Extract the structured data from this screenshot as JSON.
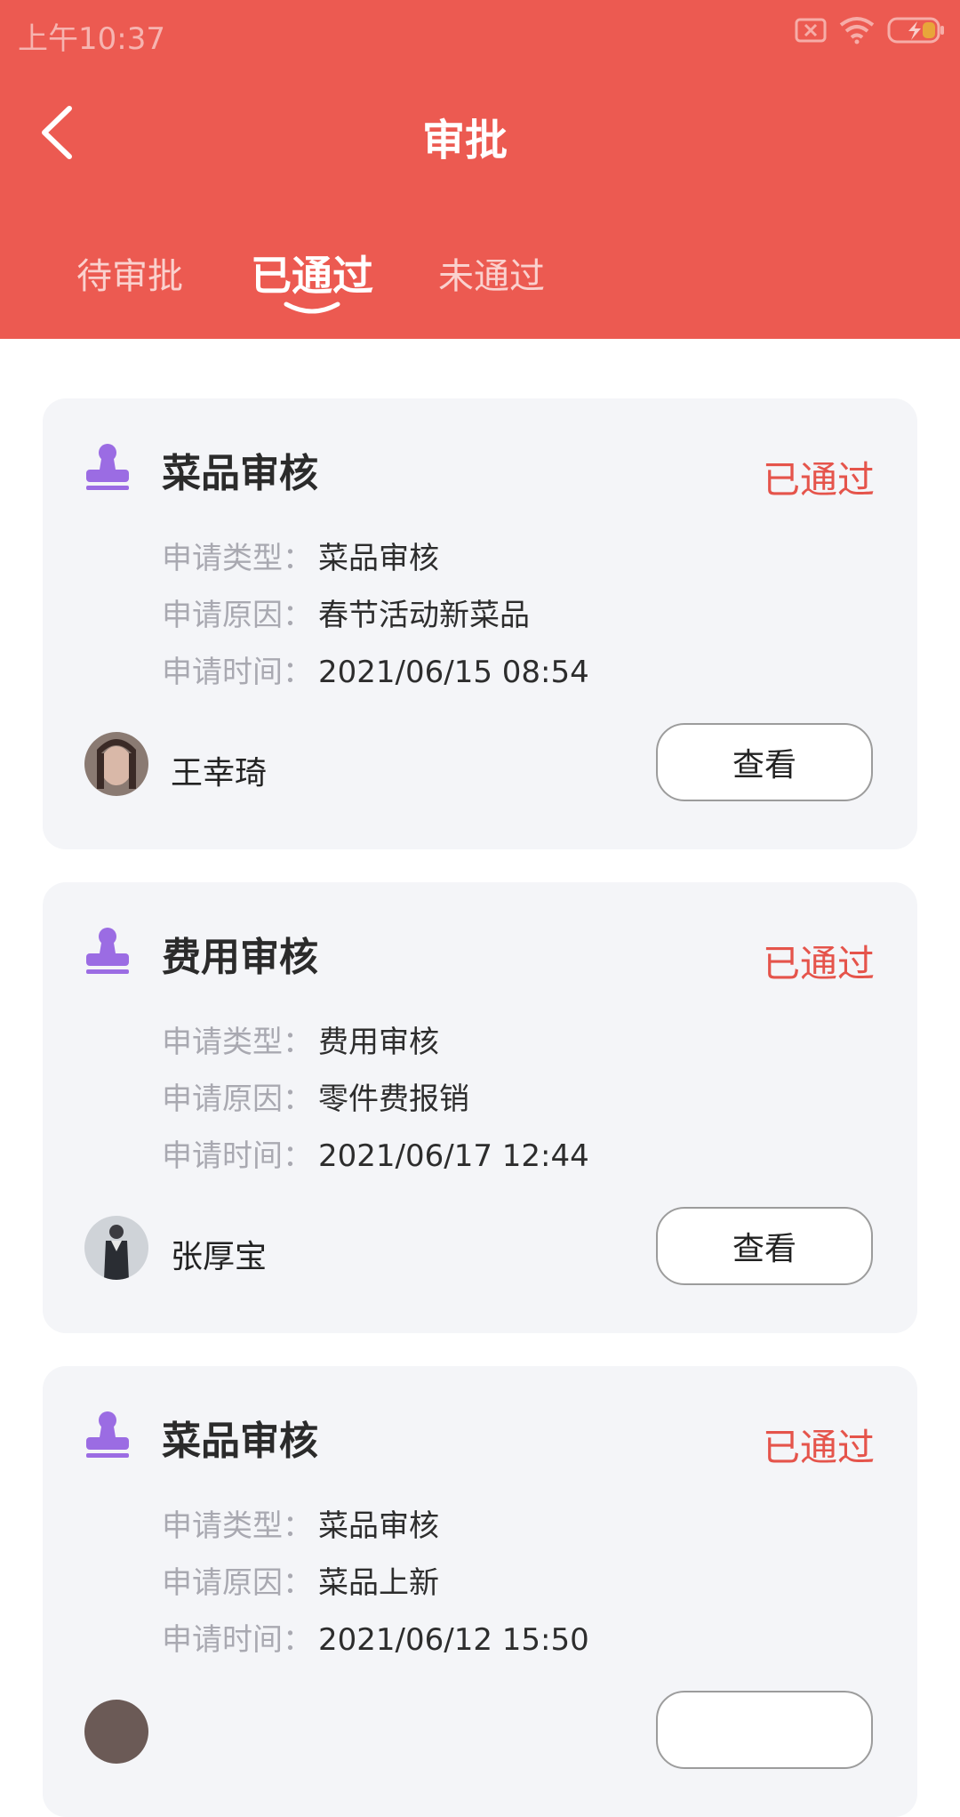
{
  "status_bar": {
    "time": "上午10:37"
  },
  "header": {
    "title": "审批"
  },
  "tabs": [
    {
      "label": "待审批"
    },
    {
      "label": "已通过"
    },
    {
      "label": "未通过"
    }
  ],
  "labels": {
    "type": "申请类型：",
    "reason": "申请原因：",
    "time": "申请时间："
  },
  "cards": [
    {
      "title": "菜品审核",
      "status": "已通过",
      "type": "菜品审核",
      "reason": "春节活动新菜品",
      "time": "2021/06/15 08:54",
      "applicant": "王幸琦",
      "button": "查看"
    },
    {
      "title": "费用审核",
      "status": "已通过",
      "type": "费用审核",
      "reason": "零件费报销",
      "time": "2021/06/17 12:44",
      "applicant": "张厚宝",
      "button": "查看"
    },
    {
      "title": "菜品审核",
      "status": "已通过",
      "type": "菜品审核",
      "reason": "菜品上新",
      "time": "2021/06/12 15:50",
      "applicant": "",
      "button": ""
    }
  ],
  "colors": {
    "header_bg": "#ec5a51",
    "status_text": "#e5544b",
    "stamp_icon": "#9b6ce3",
    "card_bg": "#f4f5f8"
  }
}
